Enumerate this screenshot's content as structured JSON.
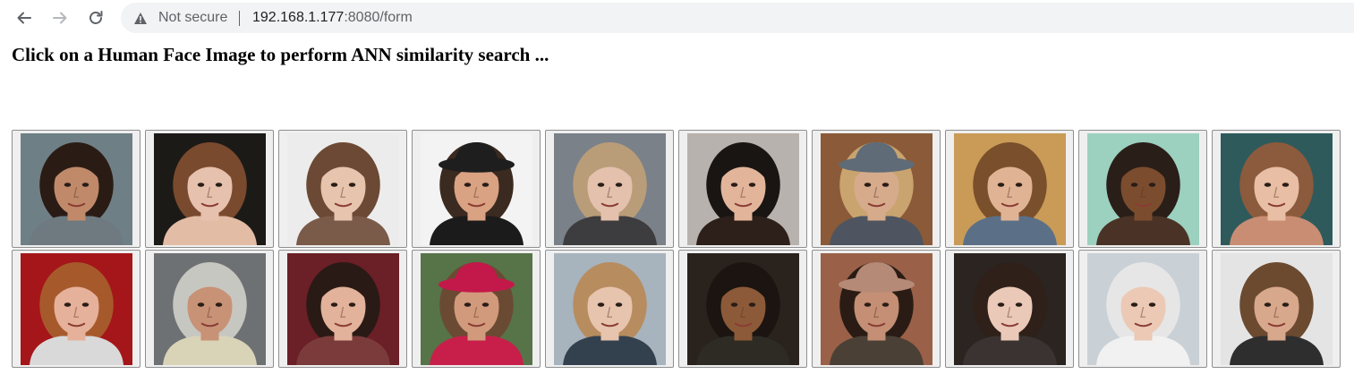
{
  "browser": {
    "security_label": "Not secure",
    "url_host": "192.168.1.177",
    "url_rest": ":8080/form",
    "icons": [
      "back-arrow-icon",
      "forward-arrow-icon",
      "reload-icon",
      "warning-triangle-icon"
    ]
  },
  "page": {
    "heading": "Click on a Human Face Image to perform ANN similarity search ..."
  },
  "faces": [
    {
      "subject": "bearded young man, dark hair",
      "bg": "#6f7f86",
      "skin": "#c08a6a",
      "hair": "#2a1c15",
      "shirt": "#6e7a80",
      "hat": null
    },
    {
      "subject": "young woman, auburn hair",
      "bg": "#1c1a17",
      "skin": "#e6c1ad",
      "hair": "#7a4a2e",
      "shirt": "#e3bca5",
      "hat": null
    },
    {
      "subject": "woman with brown bangs",
      "bg": "#ececec",
      "skin": "#e7c4ad",
      "hair": "#6c4934",
      "shirt": "#7a5a48",
      "hat": null
    },
    {
      "subject": "smiling young man in black cap",
      "bg": "#f3f3f3",
      "skin": "#d9a283",
      "hair": "#3b2a20",
      "shirt": "#1b1b1b",
      "hat": "#1e1e1e"
    },
    {
      "subject": "blonde young woman",
      "bg": "#7b8189",
      "skin": "#e3c1ad",
      "hair": "#b99d78",
      "shirt": "#3d3c3e",
      "hat": null
    },
    {
      "subject": "woman with black hair, red lips",
      "bg": "#b7b2ad",
      "skin": "#e2b59b",
      "hair": "#191513",
      "shirt": "#2d1f19",
      "hat": null
    },
    {
      "subject": "woman in grey wide-brim hat",
      "bg": "#8b5a38",
      "skin": "#d6ab8c",
      "hair": "#c9a46f",
      "shirt": "#4e5560",
      "hat": "#5f6b77"
    },
    {
      "subject": "young man in denim jacket",
      "bg": "#c99b56",
      "skin": "#e0b394",
      "hair": "#7a4f2c",
      "shirt": "#5b7087",
      "hat": null
    },
    {
      "subject": "woman with curly dark hair",
      "bg": "#9cd0bf",
      "skin": "#7b4d2e",
      "hair": "#2a1e18",
      "shirt": "#4a3326",
      "hat": null
    },
    {
      "subject": "smiling woman, light brown hair",
      "bg": "#2f5a5c",
      "skin": "#e8bfa4",
      "hair": "#8c5a3c",
      "shirt": "#c98d73",
      "hat": null
    },
    {
      "subject": "boy, red background",
      "bg": "#a5161a",
      "skin": "#e6b19a",
      "hair": "#a65a2c",
      "shirt": "#d9d9d9",
      "hat": null
    },
    {
      "subject": "elderly man, grey hair",
      "bg": "#6e7173",
      "skin": "#c89276",
      "hair": "#c7c7c2",
      "shirt": "#d9d3b8",
      "hat": null
    },
    {
      "subject": "young asian woman",
      "bg": "#6b1f27",
      "skin": "#e2b29a",
      "hair": "#2a1a15",
      "shirt": "#7b3b3b",
      "hat": null
    },
    {
      "subject": "smiling man in red graduation cap",
      "bg": "#567448",
      "skin": "#d29a7c",
      "hair": "#6b4a33",
      "shirt": "#c71f4a",
      "hat": "#c3194a"
    },
    {
      "subject": "girl with long wavy hair",
      "bg": "#a7b3bd",
      "skin": "#e6c4ad",
      "hair": "#b78c5e",
      "shirt": "#33414f",
      "hat": null
    },
    {
      "subject": "woman with bindi",
      "bg": "#2a231d",
      "skin": "#8c5a38",
      "hair": "#1b1411",
      "shirt": "#2e2a24",
      "hat": null
    },
    {
      "subject": "bearded man in knit beanie",
      "bg": "#9a6048",
      "skin": "#c48f74",
      "hair": "#2a1c15",
      "shirt": "#4b4035",
      "hat": "#b58a76"
    },
    {
      "subject": "young woman, dark hair",
      "bg": "#2b2420",
      "skin": "#ebc9b9",
      "hair": "#2f2019",
      "shirt": "#3b3331",
      "hat": null
    },
    {
      "subject": "elderly woman, white hair",
      "bg": "#c9d0d6",
      "skin": "#ecc9b5",
      "hair": "#e6e6e6",
      "shirt": "#f1f1f1",
      "hat": null
    },
    {
      "subject": "smiling young man, side-swept hair",
      "bg": "#e4e4e4",
      "skin": "#d8a88c",
      "hair": "#6b4a30",
      "shirt": "#2e2e2e",
      "hat": null
    }
  ]
}
